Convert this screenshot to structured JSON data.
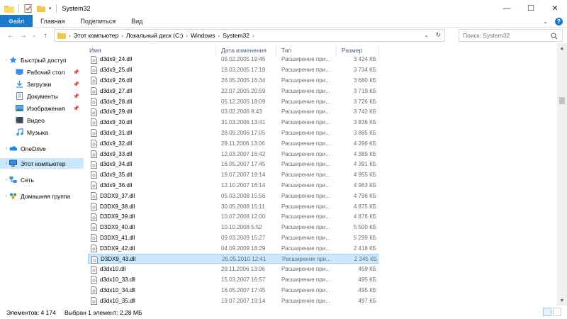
{
  "window": {
    "title": "System32"
  },
  "ribbon": {
    "tabs": [
      "Файл",
      "Главная",
      "Поделиться",
      "Вид"
    ]
  },
  "address": {
    "crumbs": [
      "Этот компьютер",
      "Локальный диск (C:)",
      "Windows",
      "System32"
    ]
  },
  "search": {
    "placeholder": "Поиск: System32"
  },
  "nav": {
    "items": [
      {
        "label": "Быстрый доступ",
        "icon": "star-icon"
      },
      {
        "label": "Рабочий стол",
        "icon": "desktop-icon"
      },
      {
        "label": "Загрузки",
        "icon": "download-icon"
      },
      {
        "label": "Документы",
        "icon": "documents-icon"
      },
      {
        "label": "Изображения",
        "icon": "pictures-icon"
      },
      {
        "label": "Видео",
        "icon": "video-icon"
      },
      {
        "label": "Музыка",
        "icon": "music-icon"
      },
      {
        "label": "OneDrive",
        "icon": "onedrive-icon"
      },
      {
        "label": "Этот компьютер",
        "icon": "computer-icon"
      },
      {
        "label": "Сеть",
        "icon": "network-icon"
      },
      {
        "label": "Домашняя группа",
        "icon": "homegroup-icon"
      }
    ]
  },
  "columns": {
    "name": "Имя",
    "date": "Дата изменения",
    "type": "Тип",
    "size": "Размер"
  },
  "files": [
    {
      "name": "d3dx9_24.dll",
      "date": "05.02.2005 19:45",
      "type": "Расширение при...",
      "size": "3 424 КБ"
    },
    {
      "name": "d3dx9_25.dll",
      "date": "18.03.2005 17:19",
      "type": "Расширение при...",
      "size": "3 734 КБ"
    },
    {
      "name": "d3dx9_26.dll",
      "date": "26.05.2005 16:34",
      "type": "Расширение при...",
      "size": "3 680 КБ"
    },
    {
      "name": "d3dx9_27.dll",
      "date": "22.07.2005 20:59",
      "type": "Расширение при...",
      "size": "3 719 КБ"
    },
    {
      "name": "d3dx9_28.dll",
      "date": "05.12.2005 18:09",
      "type": "Расширение при...",
      "size": "3 726 КБ"
    },
    {
      "name": "d3dx9_29.dll",
      "date": "03.02.2006 8:43",
      "type": "Расширение при...",
      "size": "3 742 КБ"
    },
    {
      "name": "d3dx9_30.dll",
      "date": "31.03.2006 13:41",
      "type": "Расширение при...",
      "size": "3 836 КБ"
    },
    {
      "name": "d3dx9_31.dll",
      "date": "28.09.2006 17:05",
      "type": "Расширение при...",
      "size": "3 885 КБ"
    },
    {
      "name": "d3dx9_32.dll",
      "date": "29.11.2006 13:06",
      "type": "Расширение при...",
      "size": "4 296 КБ"
    },
    {
      "name": "d3dx9_33.dll",
      "date": "12.03.2007 16:42",
      "type": "Расширение при...",
      "size": "4 389 КБ"
    },
    {
      "name": "d3dx9_34.dll",
      "date": "16.05.2007 17:45",
      "type": "Расширение при...",
      "size": "4 391 КБ"
    },
    {
      "name": "d3dx9_35.dll",
      "date": "19.07.2007 19:14",
      "type": "Расширение при...",
      "size": "4 955 КБ"
    },
    {
      "name": "d3dx9_36.dll",
      "date": "12.10.2007 16:14",
      "type": "Расширение при...",
      "size": "4 963 КБ"
    },
    {
      "name": "D3DX9_37.dll",
      "date": "05.03.2008 15:56",
      "type": "Расширение при...",
      "size": "4 796 КБ"
    },
    {
      "name": "D3DX9_38.dll",
      "date": "30.05.2008 15:11",
      "type": "Расширение при...",
      "size": "4 875 КБ"
    },
    {
      "name": "D3DX9_39.dll",
      "date": "10.07.2008 12:00",
      "type": "Расширение при...",
      "size": "4 876 КБ"
    },
    {
      "name": "D3DX9_40.dll",
      "date": "10.10.2008 5:52",
      "type": "Расширение при...",
      "size": "5 500 КБ"
    },
    {
      "name": "D3DX9_41.dll",
      "date": "09.03.2009 15:27",
      "type": "Расширение при...",
      "size": "5 299 КБ"
    },
    {
      "name": "D3DX9_42.dll",
      "date": "04.09.2009 18:29",
      "type": "Расширение при...",
      "size": "2 418 КБ"
    },
    {
      "name": "D3DX9_43.dll",
      "date": "26.05.2010 12:41",
      "type": "Расширение при...",
      "size": "2 345 КБ",
      "selected": true
    },
    {
      "name": "d3dx10.dll",
      "date": "29.11.2006 13:06",
      "type": "Расширение при...",
      "size": "459 КБ"
    },
    {
      "name": "d3dx10_33.dll",
      "date": "15.03.2007 16:57",
      "type": "Расширение при...",
      "size": "495 КБ"
    },
    {
      "name": "d3dx10_34.dll",
      "date": "16.05.2007 17:45",
      "type": "Расширение при...",
      "size": "495 КБ"
    },
    {
      "name": "d3dx10_35.dll",
      "date": "19.07.2007 19:14",
      "type": "Расширение при...",
      "size": "497 КБ"
    }
  ],
  "status": {
    "count": "Элементов: 4 174",
    "selection": "Выбран 1 элемент: 2,28 МБ"
  },
  "colors": {
    "accent": "#1979ca",
    "selection": "#cce8ff"
  }
}
